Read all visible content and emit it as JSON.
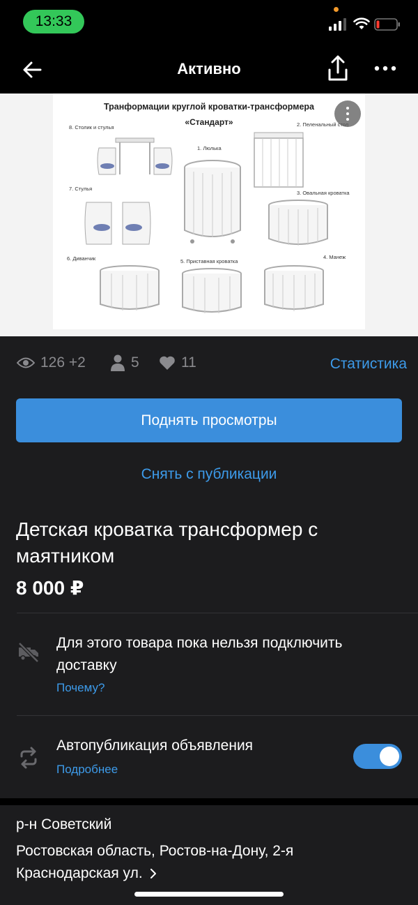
{
  "status_bar": {
    "time": "13:33"
  },
  "nav": {
    "title": "Активно"
  },
  "photo": {
    "title": "Транформации круглой кроватки-трансформера",
    "subtitle": "«Стандарт»",
    "captions": [
      "8. Столик и стулья",
      "1. Люлька",
      "2. Пеленальный стол",
      "7. Стулья",
      "3. Овальная кроватка",
      "6. Диванчик",
      "5. Приставная кроватка",
      "4. Манеж"
    ]
  },
  "stats": {
    "views": "126 +2",
    "contacts": "5",
    "favorites": "11",
    "link": "Статистика"
  },
  "actions": {
    "boost": "Поднять просмотры",
    "unpublish": "Снять с публикации"
  },
  "listing": {
    "title": "Детская кроватка трансформер с маятником",
    "price": "8 000 ₽"
  },
  "delivery": {
    "text": "Для этого товара пока нельзя подключить доставку",
    "link": "Почему?"
  },
  "autopublish": {
    "title": "Автопубликация объявления",
    "link": "Подробнее",
    "enabled": true
  },
  "location": {
    "district": "р-н Советский",
    "address": "Ростовская область, Ростов-на-Дону, 2-я Краснодарская ул."
  },
  "colors": {
    "accent": "#3b8edc",
    "link": "#3d9bea",
    "panel": "#1c1c1e",
    "time_pill": "#33c759"
  }
}
